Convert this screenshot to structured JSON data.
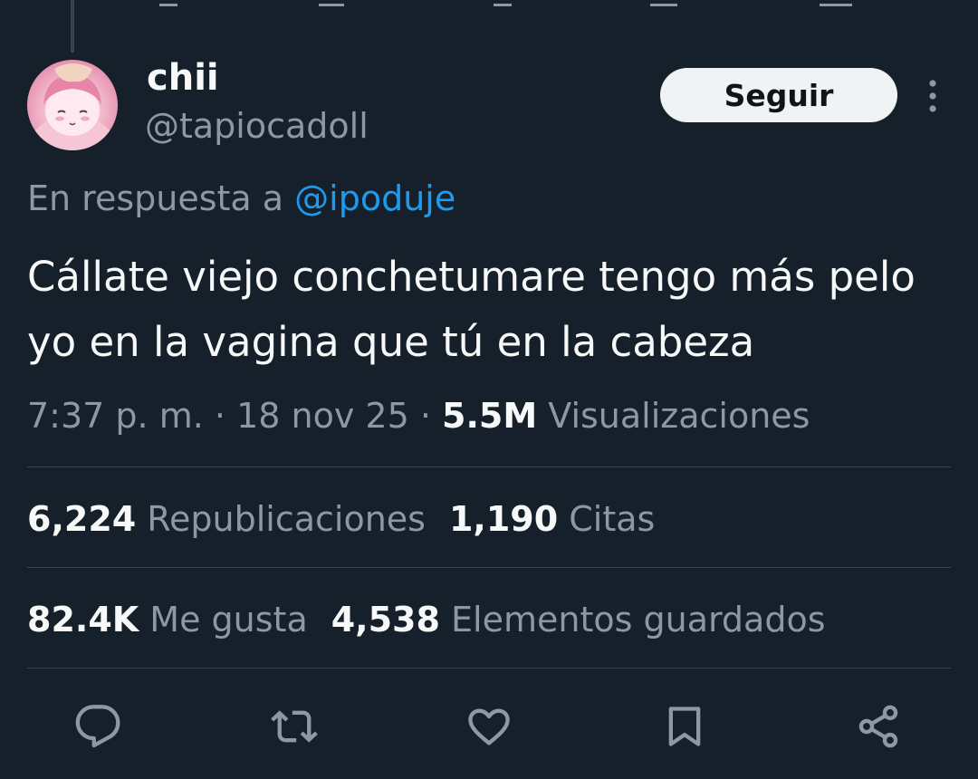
{
  "author": {
    "display_name": "chii",
    "handle": "@tapiocadoll",
    "avatar": "avatar-image"
  },
  "follow_label": "Seguir",
  "more_icon": "more-vertical-icon",
  "reply_context": {
    "prefix": "En respuesta a",
    "mention": "@ipoduje"
  },
  "tweet": {
    "text": "Cállate viejo conchetumare tengo más pelo yo en la vagina que tú en la cabeza"
  },
  "meta": {
    "time": "7:37 p. m.",
    "separator": "·",
    "date": "18 nov 25",
    "views_count": "5.5M",
    "views_label": "Visualizaciones"
  },
  "stats": {
    "reposts_count": "6,224",
    "reposts_label": "Republicaciones",
    "quotes_count": "1,190",
    "quotes_label": "Citas",
    "likes_count": "82.4K",
    "likes_label": "Me gusta",
    "bookmarks_count": "4,538",
    "bookmarks_label": "Elementos guardados"
  },
  "actions": [
    {
      "icon": "reply-icon"
    },
    {
      "icon": "repost-icon"
    },
    {
      "icon": "like-icon"
    },
    {
      "icon": "bookmark-icon"
    },
    {
      "icon": "share-icon"
    }
  ],
  "colors": {
    "background": "#15202b",
    "text_primary": "#f7f9f9",
    "text_secondary": "#8b98a5",
    "link": "#1d9bf0",
    "divider": "#38444d",
    "follow_bg": "#eff3f4"
  }
}
